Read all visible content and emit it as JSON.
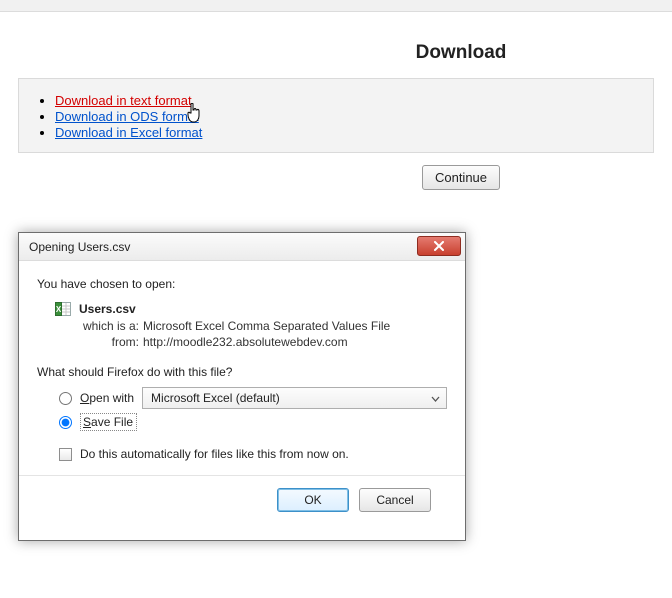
{
  "page": {
    "title": "Download",
    "links": [
      {
        "label": "Download in text format",
        "hot": true
      },
      {
        "label": "Download in ODS format",
        "hot": false
      },
      {
        "label": "Download in Excel format",
        "hot": false
      }
    ],
    "continue_label": "Continue"
  },
  "dialog": {
    "title": "Opening Users.csv",
    "intro": "You have chosen to open:",
    "filename": "Users.csv",
    "which_is_label": "which is a:",
    "which_is_value": "Microsoft Excel Comma Separated Values File",
    "from_label": "from:",
    "from_value": "http://moodle232.absolutewebdev.com",
    "question": "What should Firefox do with this file?",
    "open_with_label": "Open with",
    "open_with_mnemonic": "O",
    "open_with_value": "Microsoft Excel (default)",
    "save_file_label": "Save File",
    "save_file_mnemonic": "S",
    "auto_label": "Do this automatically for files like this from now on.",
    "ok_label": "OK",
    "cancel_label": "Cancel"
  }
}
